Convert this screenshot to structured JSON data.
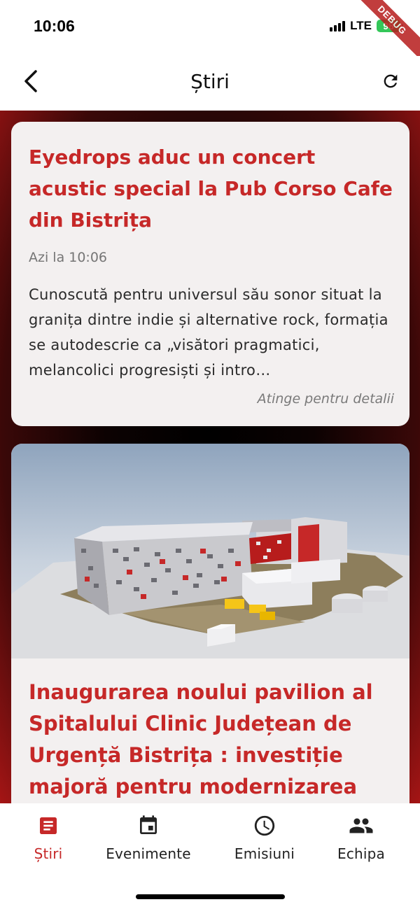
{
  "status_bar": {
    "time": "10:06",
    "network": "LTE",
    "battery": "98",
    "debug_label": "DEBUG"
  },
  "app_bar": {
    "title": "Știri",
    "back_icon": "chevron-left-icon",
    "refresh_icon": "refresh-icon"
  },
  "articles": [
    {
      "title": "Eyedrops aduc un concert acustic special la Pub Corso Cafe din Bistrița",
      "date": "Azi la 10:06",
      "excerpt": "Cunoscută pentru universul său sonor situat la granița dintre indie și alternative rock, formația se autodescrie ca „visători pragmatici, melancolici progresiști și intro…",
      "hint": "Atinge pentru detalii"
    },
    {
      "title": "Inaugurarea noului pavilion al Spitalului Clinic Județean de Urgență Bistrița : investiție majoră pentru modernizarea",
      "image": "hospital-building-rendering"
    }
  ],
  "bottom_nav": {
    "items": [
      {
        "label": "Știri",
        "icon": "article-icon",
        "active": true
      },
      {
        "label": "Evenimente",
        "icon": "calendar-icon",
        "active": false
      },
      {
        "label": "Emisiuni",
        "icon": "clock-icon",
        "active": false
      },
      {
        "label": "Echipa",
        "icon": "people-icon",
        "active": false
      }
    ]
  },
  "colors": {
    "accent": "#c62828",
    "card_background": "#f3f0f0",
    "battery": "#34c759"
  }
}
